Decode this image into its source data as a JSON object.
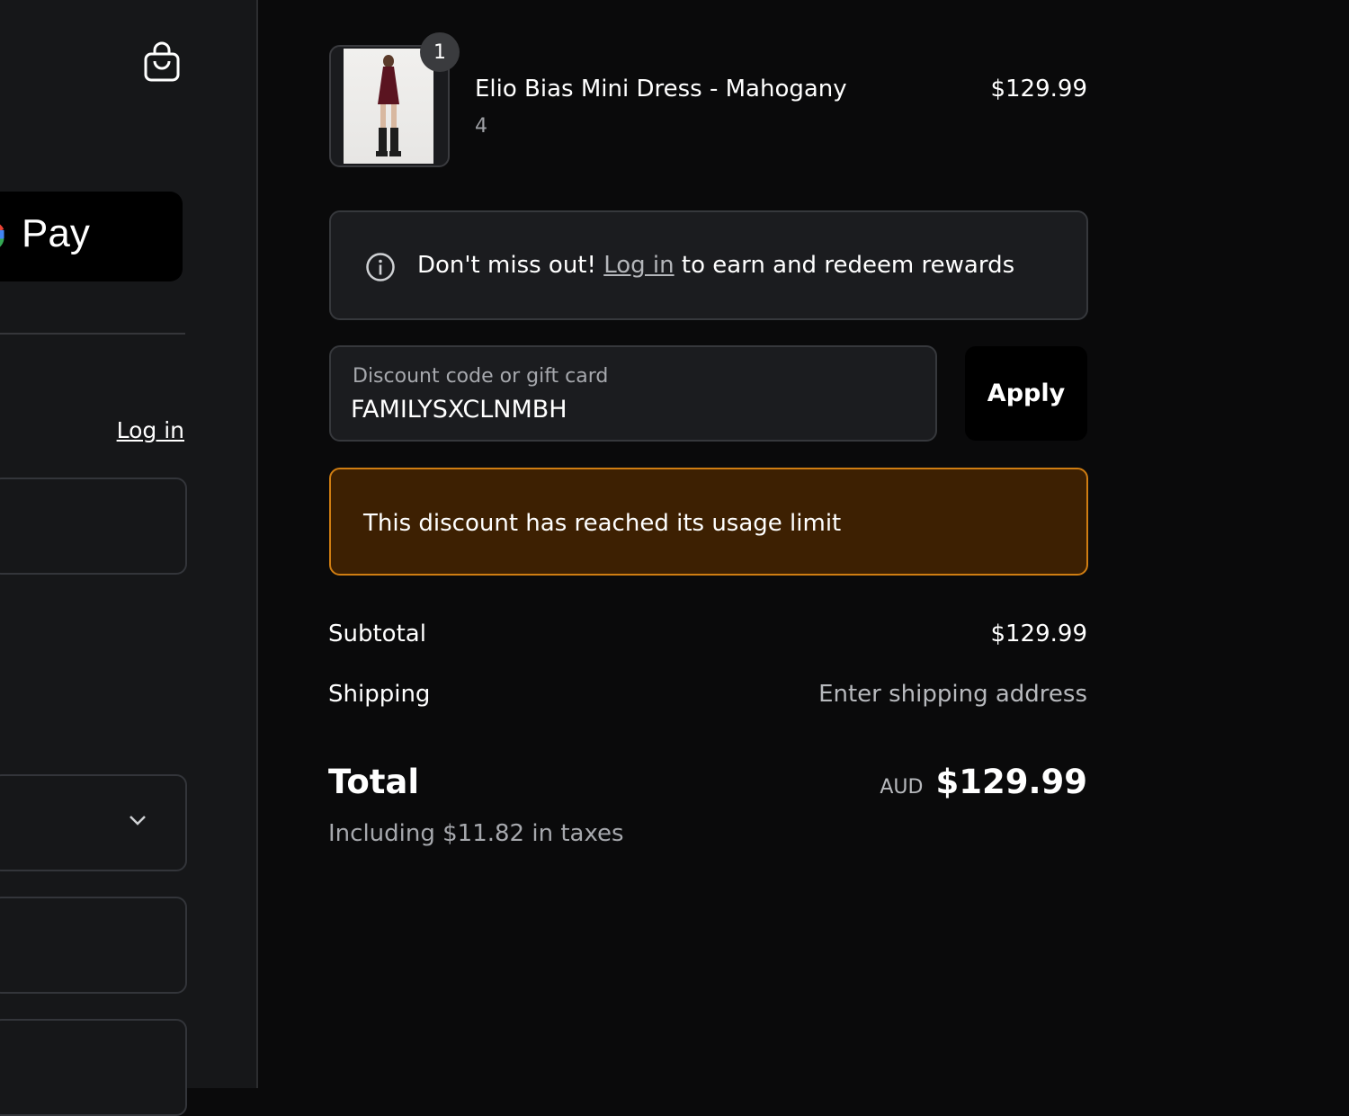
{
  "left_panel": {
    "pay_button_label": "Pay",
    "login_link": "Log in",
    "icons": {
      "cart": "shopping-bag-icon",
      "dropdown": "chevron-down-icon"
    }
  },
  "order": {
    "item": {
      "name": "Elio Bias Mini Dress - Mahogany",
      "variant": "4",
      "price": "$129.99",
      "quantity": "1"
    },
    "rewards": {
      "prefix": "Don't miss out!",
      "link": "Log in",
      "suffix": "to earn and redeem rewards"
    },
    "discount": {
      "label": "Discount code or gift card",
      "value": "FAMILYSXCLNMBH",
      "apply_label": "Apply",
      "error": "This discount has reached its usage limit"
    },
    "summary": {
      "subtotal_label": "Subtotal",
      "subtotal_value": "$129.99",
      "shipping_label": "Shipping",
      "shipping_value": "Enter shipping address",
      "total_label": "Total",
      "currency": "AUD",
      "total_value": "$129.99",
      "tax_note": "Including $11.82 in taxes"
    }
  },
  "colors": {
    "background": "#0a0a0b",
    "left_panel": "#161719",
    "error_bg": "#3d2002",
    "error_border": "#cf7d12"
  }
}
